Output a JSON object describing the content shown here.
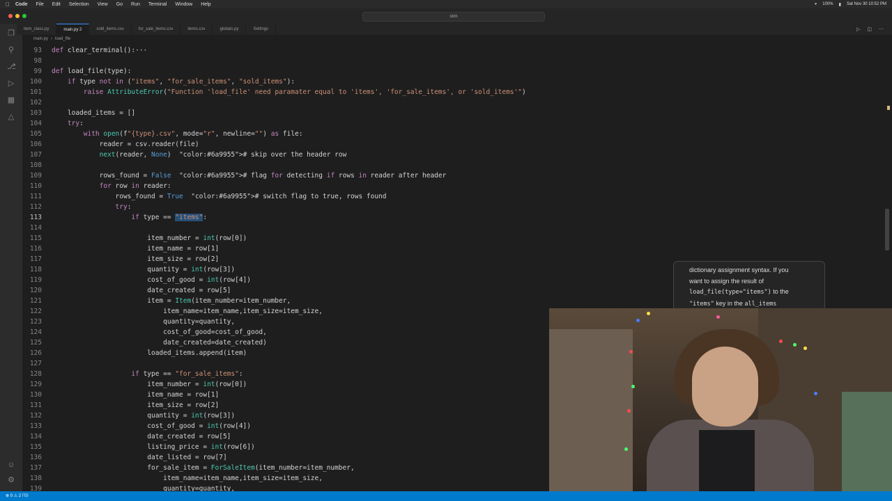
{
  "menubar": {
    "items": [
      "Code",
      "File",
      "Edit",
      "Selection",
      "View",
      "Go",
      "Run",
      "Terminal",
      "Window",
      "Help"
    ],
    "clock": "Sat Nov 30 10:52 PM",
    "battery": "100%"
  },
  "titlebar": {
    "search_text": "sbm"
  },
  "tabs": [
    "item_class.py",
    "main.py 2",
    "sold_items.csv",
    "for_sale_items.csv",
    "items.csv",
    "globals.py",
    "Settings"
  ],
  "breadcrumb": [
    "main.py",
    "load_file"
  ],
  "editor": {
    "lines": [
      {
        "n": "93",
        "text": "def clear_terminal():···"
      },
      {
        "n": "98",
        "text": ""
      },
      {
        "n": "99",
        "text": "def load_file(type):"
      },
      {
        "n": "100",
        "text": "    if type not in (\"items\", \"for_sale_items\", \"sold_items\"):"
      },
      {
        "n": "101",
        "text": "        raise AttributeError(\"Function 'load_file' need paramater equal to 'items', 'for_sale_items', or 'sold_items'\")"
      },
      {
        "n": "102",
        "text": ""
      },
      {
        "n": "103",
        "text": "    loaded_items = []"
      },
      {
        "n": "104",
        "text": "    try:"
      },
      {
        "n": "105",
        "text": "        with open(f\"{type}.csv\", mode=\"r\", newline=\"\") as file:"
      },
      {
        "n": "106",
        "text": "            reader = csv.reader(file)"
      },
      {
        "n": "107",
        "text": "            next(reader, None)  # skip over the header row"
      },
      {
        "n": "108",
        "text": ""
      },
      {
        "n": "109",
        "text": "            rows_found = False  # flag for detecting if rows in reader after header"
      },
      {
        "n": "110",
        "text": "            for row in reader:"
      },
      {
        "n": "111",
        "text": "                rows_found = True  # switch flag to true, rows found"
      },
      {
        "n": "112",
        "text": "                try:"
      },
      {
        "n": "113",
        "text": "                    if type == \"items\":"
      },
      {
        "n": "114",
        "text": ""
      },
      {
        "n": "115",
        "text": "                        item_number = int(row[0])"
      },
      {
        "n": "116",
        "text": "                        item_name = row[1]"
      },
      {
        "n": "117",
        "text": "                        item_size = row[2]"
      },
      {
        "n": "118",
        "text": "                        quantity = int(row[3])"
      },
      {
        "n": "119",
        "text": "                        cost_of_good = int(row[4])"
      },
      {
        "n": "120",
        "text": "                        date_created = row[5]"
      },
      {
        "n": "121",
        "text": "                        item = Item(item_number=item_number,"
      },
      {
        "n": "122",
        "text": "                            item_name=item_name,item_size=item_size,"
      },
      {
        "n": "123",
        "text": "                            quantity=quantity,"
      },
      {
        "n": "124",
        "text": "                            cost_of_good=cost_of_good,"
      },
      {
        "n": "125",
        "text": "                            date_created=date_created)"
      },
      {
        "n": "126",
        "text": "                        loaded_items.append(item)"
      },
      {
        "n": "127",
        "text": ""
      },
      {
        "n": "128",
        "text": "                    if type == \"for_sale_items\":"
      },
      {
        "n": "129",
        "text": "                        item_number = int(row[0])"
      },
      {
        "n": "130",
        "text": "                        item_name = row[1]"
      },
      {
        "n": "131",
        "text": "                        item_size = row[2]"
      },
      {
        "n": "132",
        "text": "                        quantity = int(row[3])"
      },
      {
        "n": "133",
        "text": "                        cost_of_good = int(row[4])"
      },
      {
        "n": "134",
        "text": "                        date_created = row[5]"
      },
      {
        "n": "135",
        "text": "                        listing_price = int(row[6])"
      },
      {
        "n": "136",
        "text": "                        date_listed = row[7]"
      },
      {
        "n": "137",
        "text": "                        for_sale_item = ForSaleItem(item_number=item_number,"
      },
      {
        "n": "138",
        "text": "                            item_name=item_name,item_size=item_size,"
      },
      {
        "n": "139",
        "text": "                            quantity=quantity,"
      }
    ]
  },
  "tooltip": {
    "line1": "dictionary assignment syntax. If you",
    "line2": "want to assign the result of",
    "line3a": "load_file(type=\"items\")",
    "line3b": " to the",
    "line4a": "\"items\"",
    "line4b": " key in the ",
    "line4c": "all_items"
  },
  "statusbar": {
    "text": "⊗ 0 ⚠ 2   ☈0"
  }
}
